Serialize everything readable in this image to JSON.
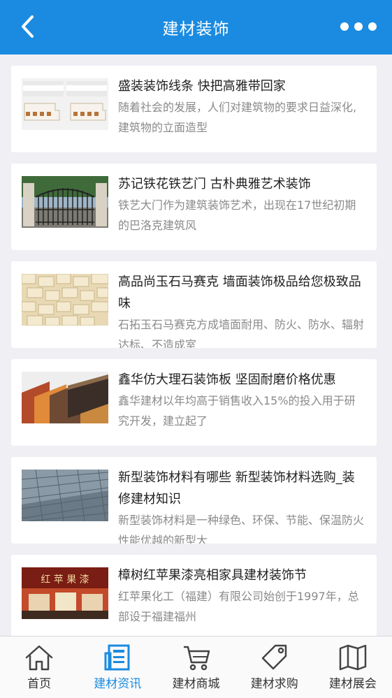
{
  "header": {
    "title": "建材装饰"
  },
  "articles": [
    {
      "title": "盛装装饰线条 快把高雅带回家",
      "desc": "随着社会的发展，人们对建筑物的要求日益深化,建筑物的立面造型"
    },
    {
      "title": "苏记铁花铁艺门 古朴典雅艺术装饰",
      "desc": "铁艺大门作为建筑装饰艺术，出现在17世纪初期的巴洛克建筑风"
    },
    {
      "title": "高品尚玉石马赛克 墙面装饰极品给您极致品味",
      "desc": "石拓玉石马赛克方成墙面耐用、防火、防水、辐射达标、不造成室"
    },
    {
      "title": "鑫华仿大理石装饰板 坚固耐磨价格优惠",
      "desc": "鑫华建材以年均高于销售收入15%的投入用于研究开发，建立起了"
    },
    {
      "title": "新型装饰材料有哪些 新型装饰材料选购_装修建材知识",
      "desc": "新型装饰材料是一种绿色、环保、节能、保温防火性能优越的新型大"
    },
    {
      "title": "樟树红苹果漆亮相家具建材装饰节",
      "desc": "红苹果化工（福建）有限公司始创于1997年，总部设于福建福州",
      "sign_text": "红 苹 果 漆"
    }
  ],
  "tabs": [
    {
      "label": "首页",
      "icon": "home-icon"
    },
    {
      "label": "建材资讯",
      "icon": "news-icon"
    },
    {
      "label": "建材商城",
      "icon": "cart-icon"
    },
    {
      "label": "建材求购",
      "icon": "tag-icon"
    },
    {
      "label": "建材展会",
      "icon": "map-icon"
    }
  ],
  "active_tab": 1,
  "colors": {
    "primary": "#1a8be0",
    "background": "#efeff4",
    "title_text": "#1f1f1f",
    "desc_text": "#8a8a8a"
  }
}
